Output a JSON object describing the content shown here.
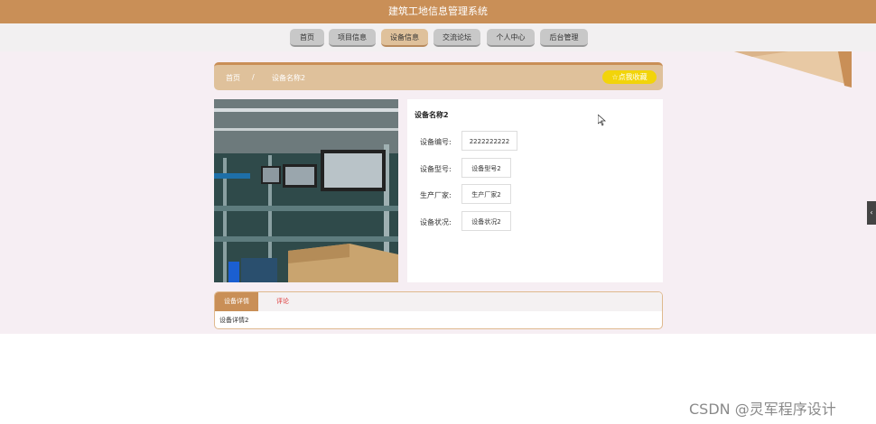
{
  "header": {
    "title": "建筑工地信息管理系统"
  },
  "nav": {
    "items": [
      {
        "label": "首页"
      },
      {
        "label": "项目信息"
      },
      {
        "label": "设备信息"
      },
      {
        "label": "交流论坛"
      },
      {
        "label": "个人中心"
      },
      {
        "label": "后台管理"
      }
    ],
    "active_label": "设备信息"
  },
  "breadcrumb": {
    "home": "首页",
    "separator": "/",
    "current": "设备名称2"
  },
  "favorite": {
    "icon": "star-icon",
    "label": "点我收藏"
  },
  "detail": {
    "title": "设备名称2",
    "fields": [
      {
        "label": "设备编号:",
        "value": "2222222222"
      },
      {
        "label": "设备型号:",
        "value": "设备型号2"
      },
      {
        "label": "生产厂家:",
        "value": "生产厂家2"
      },
      {
        "label": "设备状况:",
        "value": "设备状况2"
      }
    ]
  },
  "tabs": {
    "items": [
      {
        "label": "设备详情"
      },
      {
        "label": "评论"
      }
    ],
    "content": "设备详情2"
  },
  "side_handle": {
    "icon": "chevron-left-icon",
    "glyph": "‹"
  },
  "watermark": "CSDN @灵军程序设计",
  "colors": {
    "header": "#c98f57",
    "nav_active": "#dfc19b",
    "breadcrumb": "#dfc19b",
    "favorite": "#f2d40a",
    "content_bg": "#f6eef3",
    "comment_tab": "#dd3333"
  }
}
